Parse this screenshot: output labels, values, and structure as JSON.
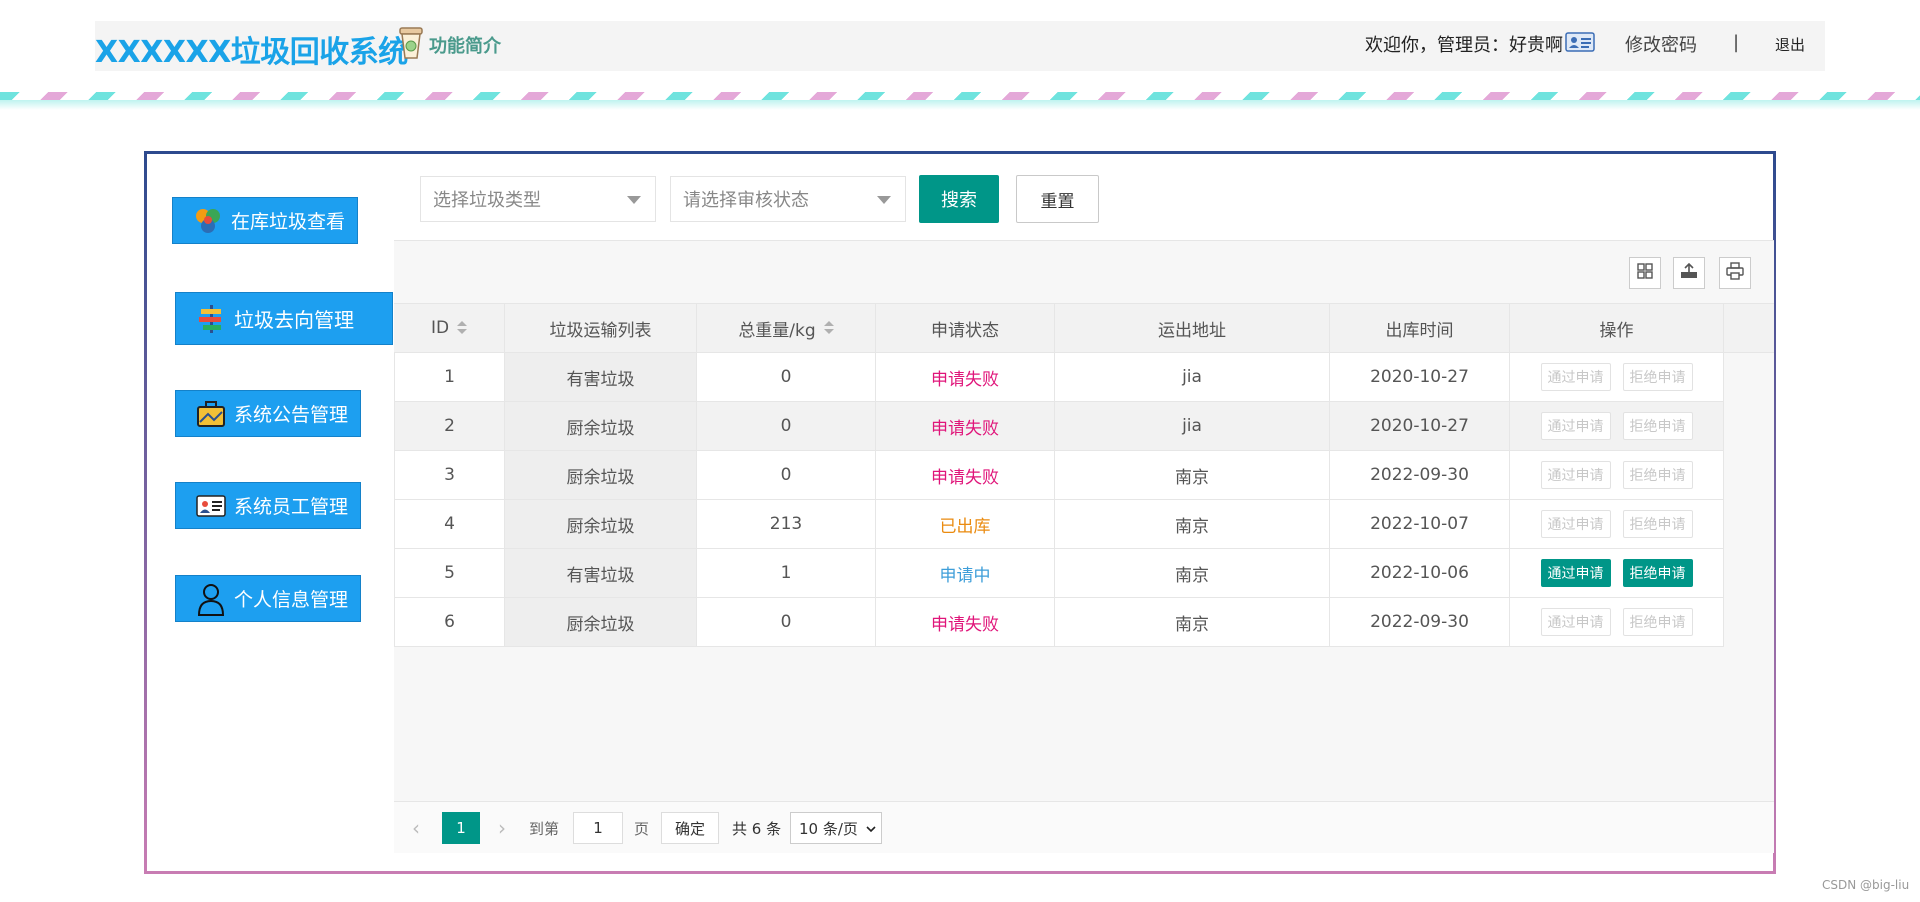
{
  "header": {
    "title": "XXXXXX垃圾回收系统",
    "intro_label": "功能简介",
    "welcome": "欢迎你，管理员：好贵啊",
    "change_password": "修改密码",
    "separator": "|",
    "logout": "退出"
  },
  "sidebar": {
    "items": [
      {
        "label": "在库垃圾查看",
        "icon": "recycle-icon"
      },
      {
        "label": "垃圾去向管理",
        "icon": "signpost-icon"
      },
      {
        "label": "系统公告管理",
        "icon": "briefcase-icon"
      },
      {
        "label": "系统员工管理",
        "icon": "id-card-icon"
      },
      {
        "label": "个人信息管理",
        "icon": "user-icon"
      }
    ]
  },
  "search": {
    "type_placeholder": "选择垃圾类型",
    "status_placeholder": "请选择审核状态",
    "search_label": "搜索",
    "reset_label": "重置"
  },
  "table": {
    "columns": [
      "ID",
      "垃圾运输列表",
      "总重量/kg",
      "申请状态",
      "运出地址",
      "出库时间",
      "操作"
    ],
    "approve_label": "通过申请",
    "reject_label": "拒绝申请",
    "rows": [
      {
        "id": "1",
        "type": "有害垃圾",
        "weight": "0",
        "status": "申请失败",
        "address": "jia",
        "time": "2020-10-27",
        "actions_enabled": false
      },
      {
        "id": "2",
        "type": "厨余垃圾",
        "weight": "0",
        "status": "申请失败",
        "address": "jia",
        "time": "2020-10-27",
        "actions_enabled": false
      },
      {
        "id": "3",
        "type": "厨余垃圾",
        "weight": "0",
        "status": "申请失败",
        "address": "南京",
        "time": "2022-09-30",
        "actions_enabled": false
      },
      {
        "id": "4",
        "type": "厨余垃圾",
        "weight": "213",
        "status": "已出库",
        "address": "南京",
        "time": "2022-10-07",
        "actions_enabled": false
      },
      {
        "id": "5",
        "type": "有害垃圾",
        "weight": "1",
        "status": "申请中",
        "address": "南京",
        "time": "2022-10-06",
        "actions_enabled": true
      },
      {
        "id": "6",
        "type": "厨余垃圾",
        "weight": "0",
        "status": "申请失败",
        "address": "南京",
        "time": "2022-09-30",
        "actions_enabled": false
      }
    ]
  },
  "pager": {
    "prev": "‹",
    "current": "1",
    "next": "›",
    "goto_label": "到第",
    "goto_value": "1",
    "page_unit": "页",
    "confirm": "确定",
    "total": "共 6 条",
    "page_size": "10 条/页"
  },
  "watermark": "CSDN @big-liu",
  "colors": {
    "accent": "#009688",
    "sidebar": "#1d9ff0",
    "title": "#1aa3e8",
    "status_fail": "#e0157a",
    "status_out": "#ea8b10",
    "status_pending": "#3e9ed9"
  }
}
